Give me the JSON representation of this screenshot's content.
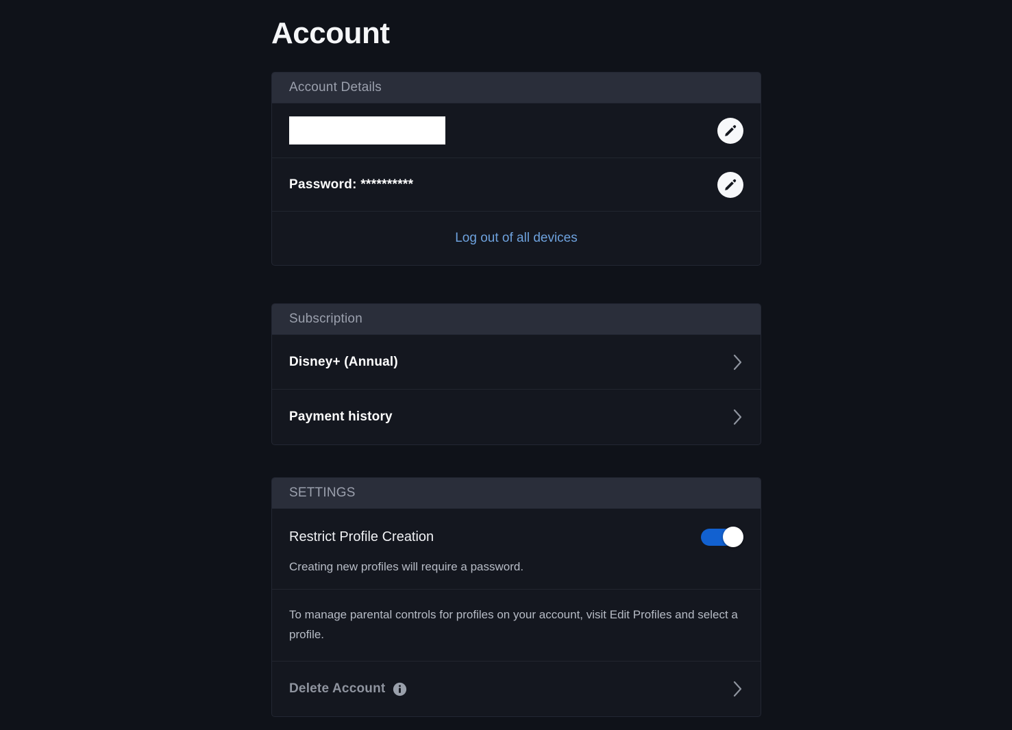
{
  "page": {
    "title": "Account",
    "background_color": "#0f1219"
  },
  "account_details": {
    "header": "Account Details",
    "email_row": {
      "value": "",
      "redacted": true,
      "edit_icon": "pencil-icon"
    },
    "password_row": {
      "label": "Password:",
      "masked_value": "**********",
      "text": "Password: **********",
      "edit_icon": "pencil-icon"
    },
    "logout_link": "Log out of all devices",
    "link_color": "#6ea2de"
  },
  "subscription": {
    "header": "Subscription",
    "items": [
      {
        "label": "Disney+ (Annual)",
        "chevron": "chevron-right-icon"
      },
      {
        "label": "Payment history",
        "chevron": "chevron-right-icon"
      }
    ]
  },
  "settings": {
    "header": "SETTINGS",
    "restrict_profile_creation": {
      "label": "Restrict Profile Creation",
      "description": "Creating new profiles will require a password.",
      "toggle_state": "on",
      "toggle_color": "#1261d0"
    },
    "parental_note": "To manage parental controls for profiles on your account, visit Edit Profiles and select a profile.",
    "delete_account": {
      "label": "Delete Account",
      "info_icon": "info-icon",
      "chevron": "chevron-right-icon"
    }
  }
}
